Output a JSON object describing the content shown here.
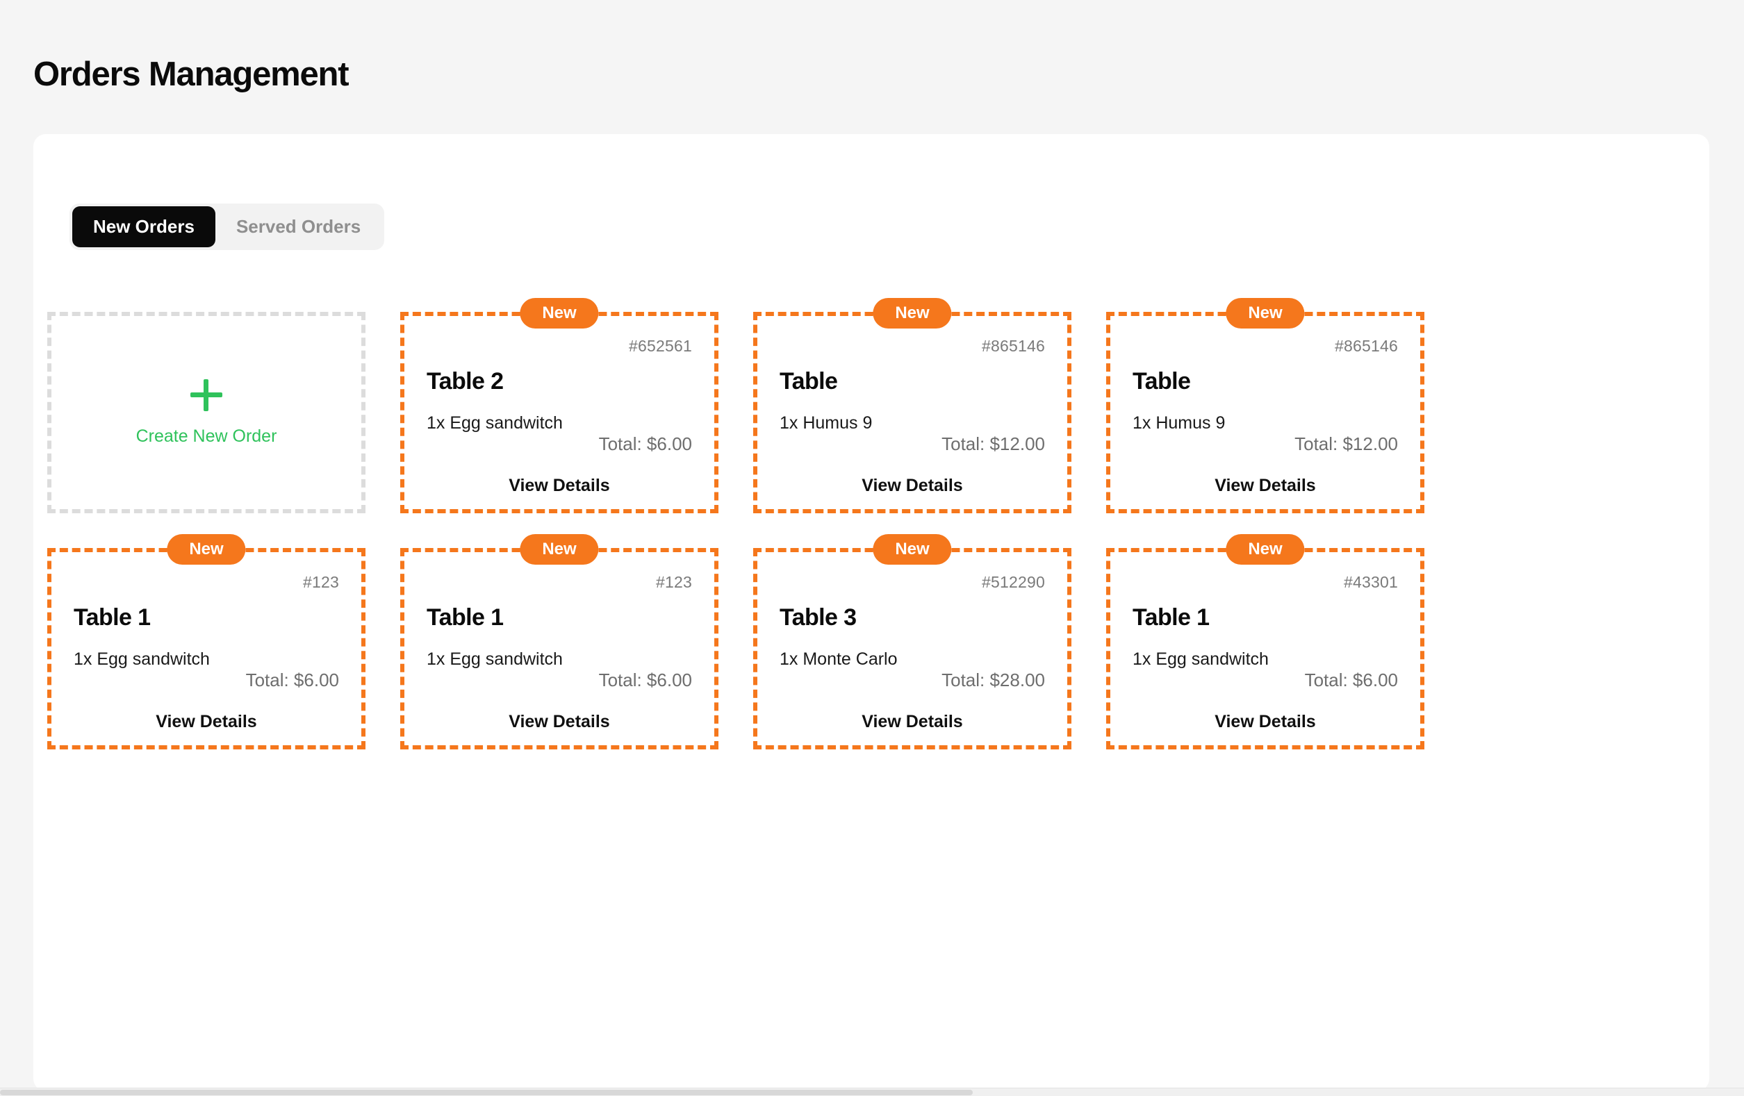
{
  "header": {
    "title": "Orders Management"
  },
  "tabs": [
    {
      "label": "New Orders",
      "active": true
    },
    {
      "label": "Served Orders",
      "active": false
    }
  ],
  "create_card": {
    "label": "Create New Order",
    "icon": "plus-icon",
    "accent_color": "#2fc25b"
  },
  "colors": {
    "page_background": "#f5f5f5",
    "panel_background": "#ffffff",
    "order_accent": "#f5771c",
    "create_accent": "#2fc25b",
    "tab_active_background": "#0a0a0a",
    "muted_text": "#7a7a7a"
  },
  "labels": {
    "badge": "New",
    "view_details": "View Details"
  },
  "orders": [
    {
      "badge": "New",
      "order_id": "#652561",
      "table": "Table 2",
      "items": "1x Egg sandwitch",
      "total": "Total: $6.00",
      "view_details": "View Details"
    },
    {
      "badge": "New",
      "order_id": "#865146",
      "table": "Table",
      "items": "1x Humus 9",
      "total": "Total: $12.00",
      "view_details": "View Details"
    },
    {
      "badge": "New",
      "order_id": "#865146",
      "table": "Table",
      "items": "1x Humus 9",
      "total": "Total: $12.00",
      "view_details": "View Details"
    },
    {
      "badge": "New",
      "order_id": "#123",
      "table": "Table 1",
      "items": "1x Egg sandwitch",
      "total": "Total: $6.00",
      "view_details": "View Details"
    },
    {
      "badge": "New",
      "order_id": "#123",
      "table": "Table 1",
      "items": "1x Egg sandwitch",
      "total": "Total: $6.00",
      "view_details": "View Details"
    },
    {
      "badge": "New",
      "order_id": "#512290",
      "table": "Table 3",
      "items": "1x Monte Carlo",
      "total": "Total: $28.00",
      "view_details": "View Details"
    },
    {
      "badge": "New",
      "order_id": "#43301",
      "table": "Table 1",
      "items": "1x Egg sandwitch",
      "total": "Total: $6.00",
      "view_details": "View Details"
    }
  ]
}
